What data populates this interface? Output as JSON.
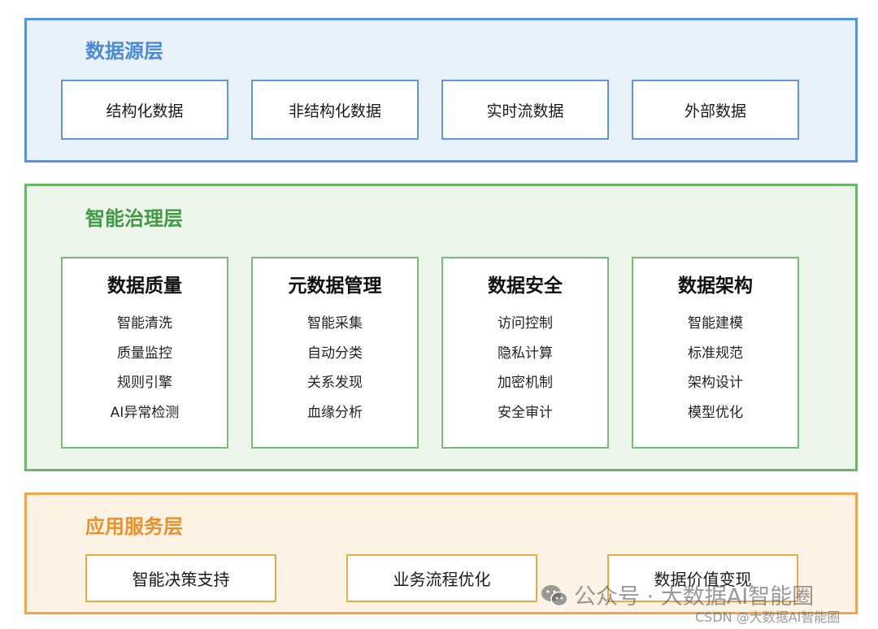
{
  "source_layer": {
    "title": "数据源层",
    "items": [
      "结构化数据",
      "非结构化数据",
      "实时流数据",
      "外部数据"
    ]
  },
  "governance_layer": {
    "title": "智能治理层",
    "cards": [
      {
        "title": "数据质量",
        "items": [
          "智能清洗",
          "质量监控",
          "规则引擎",
          "AI异常检测"
        ]
      },
      {
        "title": "元数据管理",
        "items": [
          "智能采集",
          "自动分类",
          "关系发现",
          "血缘分析"
        ]
      },
      {
        "title": "数据安全",
        "items": [
          "访问控制",
          "隐私计算",
          "加密机制",
          "安全审计"
        ]
      },
      {
        "title": "数据架构",
        "items": [
          "智能建模",
          "标准规范",
          "架构设计",
          "模型优化"
        ]
      }
    ]
  },
  "application_layer": {
    "title": "应用服务层",
    "items": [
      "智能决策支持",
      "业务流程优化",
      "数据价值变现"
    ]
  },
  "watermark": {
    "text": "公众号 · 大数据AI智能圈",
    "icon": "wechat-icon",
    "csdn": "CSDN @大数据AI智能圈"
  },
  "colors": {
    "source_accent": "#4a8ad8",
    "governance_accent": "#3f9a43",
    "application_accent": "#ed8f2b"
  }
}
